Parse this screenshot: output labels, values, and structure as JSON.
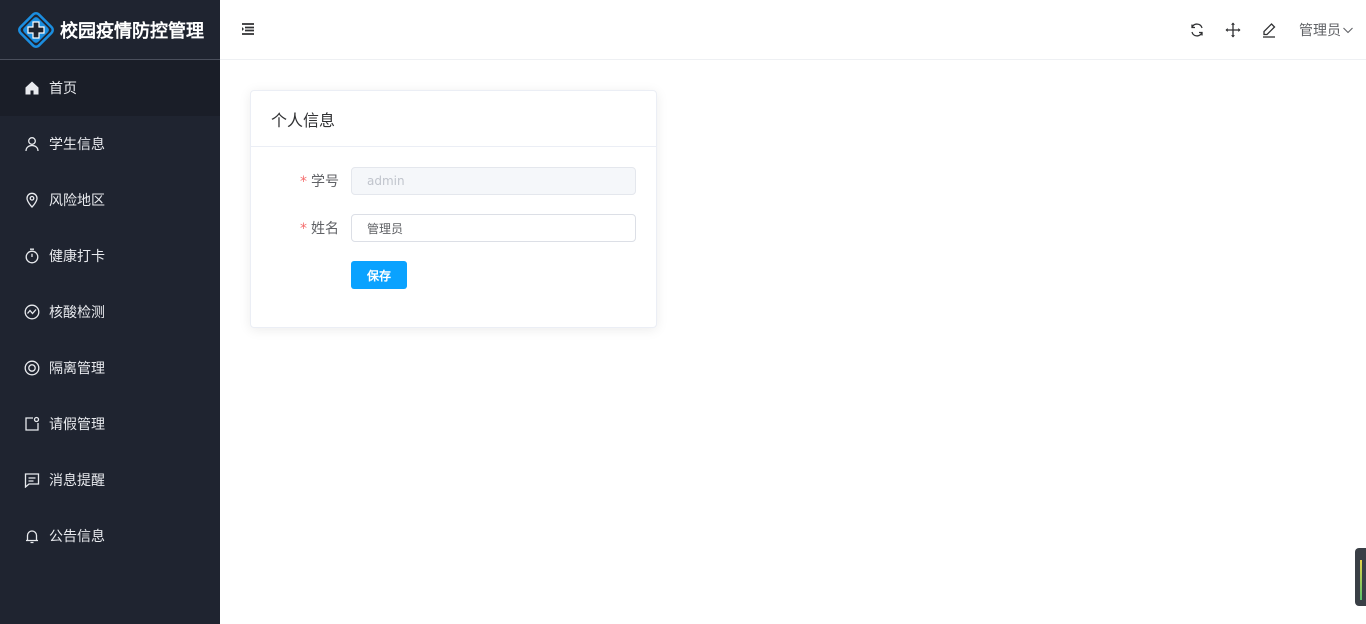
{
  "app": {
    "title": "校园疫情防控管理"
  },
  "sidebar": {
    "items": [
      {
        "label": "首页",
        "icon": "home-icon",
        "active": true
      },
      {
        "label": "学生信息",
        "icon": "user-icon",
        "active": false
      },
      {
        "label": "风险地区",
        "icon": "location-icon",
        "active": false
      },
      {
        "label": "健康打卡",
        "icon": "timer-icon",
        "active": false
      },
      {
        "label": "核酸检测",
        "icon": "chart-circle-icon",
        "active": false
      },
      {
        "label": "隔离管理",
        "icon": "lifebuoy-icon",
        "active": false
      },
      {
        "label": "请假管理",
        "icon": "note-icon",
        "active": false
      },
      {
        "label": "消息提醒",
        "icon": "message-icon",
        "active": false
      },
      {
        "label": "公告信息",
        "icon": "bell-icon",
        "active": false
      }
    ]
  },
  "header": {
    "user_name": "管理员",
    "tools": [
      "refresh-icon",
      "fullscreen-move-icon",
      "edit-icon"
    ]
  },
  "card": {
    "title": "个人信息",
    "student_id_label": "学号",
    "student_id_value": "admin",
    "name_label": "姓名",
    "name_value": "管理员",
    "required_mark": "*",
    "save_label": "保存"
  },
  "colors": {
    "sidebar_bg": "#1f2430",
    "primary": "#0aa2ff",
    "brand_accent": "#1b8ee0",
    "required": "#f56c6c"
  }
}
